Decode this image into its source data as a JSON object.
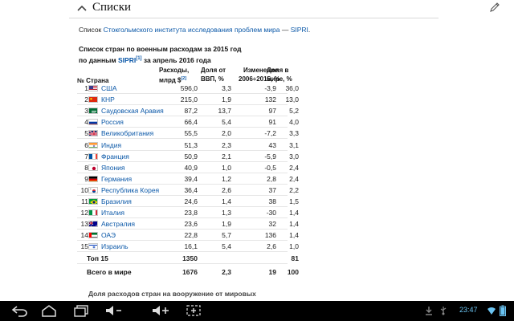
{
  "section": {
    "title": "Списки"
  },
  "intro": {
    "prefix": "Список ",
    "link": "Стокгольмского института исследования проблем мира",
    "dash": " — ",
    "abbr": "SIPRI",
    "suffix": "."
  },
  "caption": {
    "line1": "Список стран по военным расходам за 2015 год",
    "line2_prefix": "по данным ",
    "line2_link": "SIPRI",
    "line2_ref": "[1]",
    "line2_suffix": " за апрель 2016 года"
  },
  "table": {
    "headers": {
      "num_country": "№ Страна",
      "spend_l1": "Расходы,",
      "spend_l2": "млрд $",
      "spend_ref": "[2]",
      "gdp_l1": "Доля от",
      "gdp_l2": "ВВП, %",
      "chg_l1": "Изменение",
      "chg_l2": "2006÷2015, %",
      "share_l1": "Доля в",
      "share_l2": "мире, %"
    },
    "rows": [
      {
        "n": "1",
        "country": "США",
        "spend": "596,0",
        "gdp": "3,3",
        "chg": "-3,9",
        "share": "36,0"
      },
      {
        "n": "2",
        "country": "КНР",
        "spend": "215,0",
        "gdp": "1,9",
        "chg": "132",
        "share": "13,0"
      },
      {
        "n": "3",
        "country": "Саудовская Аравия",
        "spend": "87,2",
        "gdp": "13,7",
        "chg": "97",
        "share": "5,2"
      },
      {
        "n": "4",
        "country": "Россия",
        "spend": "66,4",
        "gdp": "5,4",
        "chg": "91",
        "share": "4,0"
      },
      {
        "n": "5",
        "country": "Великобритания",
        "spend": "55,5",
        "gdp": "2,0",
        "chg": "-7,2",
        "share": "3,3"
      },
      {
        "n": "6",
        "country": "Индия",
        "spend": "51,3",
        "gdp": "2,3",
        "chg": "43",
        "share": "3,1"
      },
      {
        "n": "7",
        "country": "Франция",
        "spend": "50,9",
        "gdp": "2,1",
        "chg": "-5,9",
        "share": "3,0"
      },
      {
        "n": "8",
        "country": "Япония",
        "spend": "40,9",
        "gdp": "1,0",
        "chg": "-0,5",
        "share": "2,4"
      },
      {
        "n": "9",
        "country": "Германия",
        "spend": "39,4",
        "gdp": "1,2",
        "chg": "2,8",
        "share": "2,4"
      },
      {
        "n": "10",
        "country": "Республика Корея",
        "spend": "36,4",
        "gdp": "2,6",
        "chg": "37",
        "share": "2,2"
      },
      {
        "n": "11",
        "country": "Бразилия",
        "spend": "24,6",
        "gdp": "1,4",
        "chg": "38",
        "share": "1,5"
      },
      {
        "n": "12",
        "country": "Италия",
        "spend": "23,8",
        "gdp": "1,3",
        "chg": "-30",
        "share": "1,4"
      },
      {
        "n": "13",
        "country": "Австралия",
        "spend": "23,6",
        "gdp": "1,9",
        "chg": "32",
        "share": "1,4"
      },
      {
        "n": "14",
        "country": "ОАЭ",
        "spend": "22,8",
        "gdp": "5,7",
        "chg": "136",
        "share": "1,4"
      },
      {
        "n": "15",
        "country": "Израиль",
        "spend": "16,1",
        "gdp": "5,4",
        "chg": "2,6",
        "share": "1,0"
      }
    ],
    "top15": {
      "label": "Топ 15",
      "spend": "1350",
      "gdp": "",
      "chg": "",
      "share": "81"
    },
    "world": {
      "label": "Всего в мире",
      "spend": "1676",
      "gdp": "2,3",
      "chg": "19",
      "share": "100"
    }
  },
  "next_caption": "Доля расходов стран на вооружение от мировых",
  "status": {
    "time": "23:47"
  },
  "colors": {
    "link": "#0b58a8",
    "taskbar": "#000000",
    "status_text": "#6bc4f2"
  },
  "icons": [
    "chevron-up-icon",
    "pencil-icon",
    "back-icon",
    "home-icon",
    "recent-apps-icon",
    "volume-down-icon",
    "volume-up-icon",
    "screenshot-icon",
    "download-icon",
    "usb-icon",
    "wifi-icon",
    "battery-icon"
  ]
}
